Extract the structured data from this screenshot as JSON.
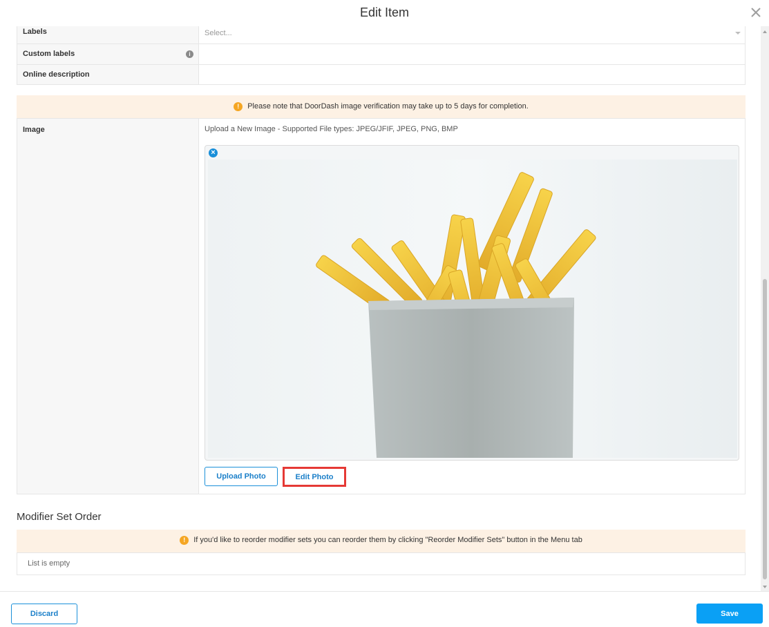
{
  "modal": {
    "title": "Edit Item",
    "close_icon": "close-icon"
  },
  "fields": {
    "labels": {
      "label": "Labels",
      "placeholder": "Select..."
    },
    "custom_labels": {
      "label": "Custom labels",
      "info_icon": "info-icon",
      "value": ""
    },
    "online_description": {
      "label": "Online description",
      "value": ""
    }
  },
  "image_notice": {
    "icon": "warning-icon",
    "text": "Please note that DoorDash image verification may take up to 5 days for completion."
  },
  "image_section": {
    "label": "Image",
    "hint": "Upload a New Image - Supported File types: JPEG/JFIF, JPEG, PNG, BMP",
    "remove_icon": "remove-image-icon",
    "upload_label": "Upload Photo",
    "edit_label": "Edit Photo"
  },
  "modifier_section": {
    "title": "Modifier Set Order",
    "notice": "If you'd like to reorder modifier sets you can reorder them by clicking \"Reorder Modifier Sets\" button in the Menu tab",
    "empty_text": "List is empty"
  },
  "footer": {
    "discard_label": "Discard",
    "save_label": "Save"
  },
  "colors": {
    "accent": "#0aa0f5",
    "notice_bg": "#fdf1e4",
    "warning": "#f5a623",
    "highlight": "#e53935"
  }
}
